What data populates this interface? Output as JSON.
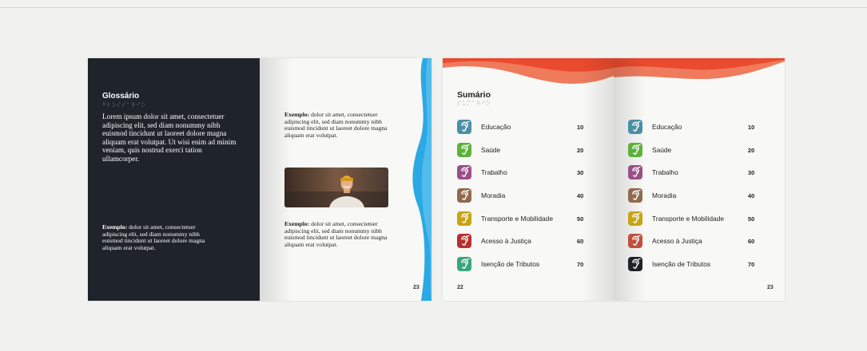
{
  "glossary": {
    "title": "Glossário",
    "braille": "⠛⠇⠕⠎⠎⠁⠗⠊⠕",
    "body": "Lorem ipsum dolor sit amet, consectetuer adipiscing elit, sed diam nonummy nibh euismod tincidunt ut laoreet dolore magna aliquam erat volutpat. Ut wisi enim ad minim veniam, quis nostrud exerci tation ullamcorper.",
    "example_label": "Exemplo:",
    "example_text": " dolor sit amet, consectetuer adipiscing elit, sed diam nonummy nibh euismod tincidunt ut laoreet dolore magna aliquam erat volutpat."
  },
  "examples_page": {
    "example1_label": "Exemplo:",
    "example1_text": " dolor sit amet, consectetuer adipiscing elit, sed diam nonummy nibh euismod tincidunt ut laoreet dolore magna aliquam erat volutpat.",
    "example2_label": "Exemplo:",
    "example2_text": " dolor sit amet, consectetuer adipiscing elit, sed diam nonummy nibh euismod tincidunt ut laoreet dolore magna aliquam erat volutpat.",
    "page_number": "23"
  },
  "summary_left": {
    "title": "Sumário",
    "braille": "⠎⠥⠍⠁⠗⠊⠕",
    "page_number": "22",
    "items": [
      {
        "label": "Educação",
        "page": "10",
        "color": "#4b8fa6"
      },
      {
        "label": "Saúde",
        "page": "20",
        "color": "#5eb13c"
      },
      {
        "label": "Trabalho",
        "page": "30",
        "color": "#9a4f88"
      },
      {
        "label": "Moradia",
        "page": "40",
        "color": "#8f6a4e"
      },
      {
        "label": "Transporte e Mobilidade",
        "page": "50",
        "color": "#c7a416"
      },
      {
        "label": "Acesso à Justiça",
        "page": "60",
        "color": "#b5302f"
      },
      {
        "label": "Isenção de Tributos",
        "page": "70",
        "color": "#3aa77a"
      }
    ]
  },
  "summary_right": {
    "page_number": "23",
    "items": [
      {
        "label": "Educação",
        "page": "10",
        "color": "#4b8fa6"
      },
      {
        "label": "Saúde",
        "page": "20",
        "color": "#5eb13c"
      },
      {
        "label": "Trabalho",
        "page": "30",
        "color": "#9a4f88"
      },
      {
        "label": "Moradia",
        "page": "40",
        "color": "#8f6a4e"
      },
      {
        "label": "Transporte e Mobilidade",
        "page": "50",
        "color": "#c7a416"
      },
      {
        "label": "Acesso à Justiça",
        "page": "60",
        "color": "#c0503a"
      },
      {
        "label": "Isenção de Tributos",
        "page": "70",
        "color": "#1e2228"
      }
    ]
  },
  "colors": {
    "dark_page": "#1f232a",
    "wave_blue": "#2aa9e4",
    "wave_orange": "#ef6a4c"
  },
  "icons": {
    "toc_icon": "hearing-icon"
  }
}
